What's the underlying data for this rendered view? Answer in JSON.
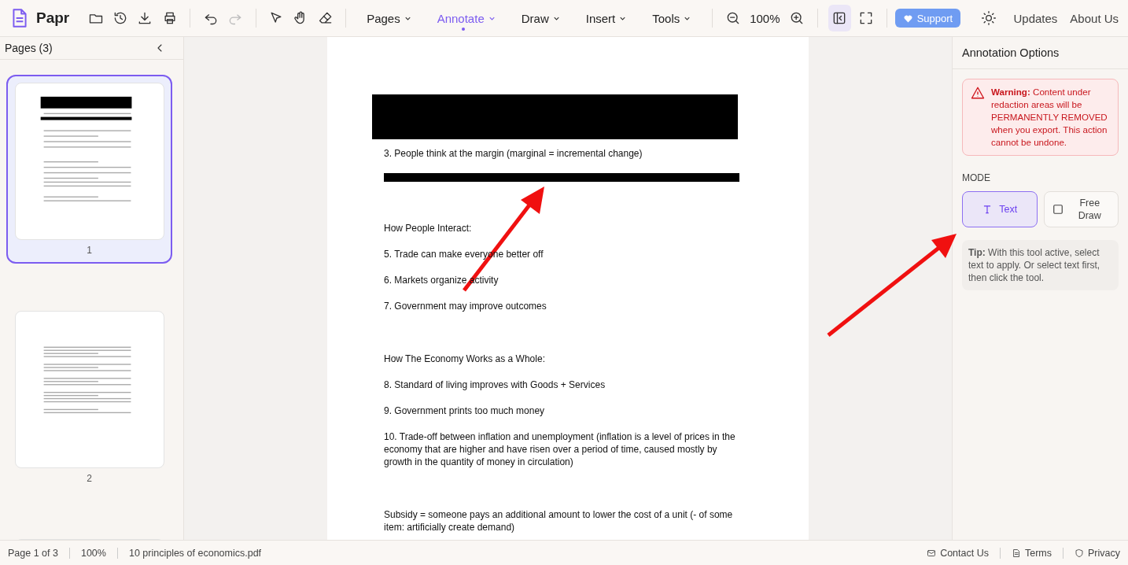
{
  "toolbar": {
    "app_name": "Papr",
    "menus": [
      {
        "label": "Pages",
        "selected": false
      },
      {
        "label": "Annotate",
        "selected": true
      },
      {
        "label": "Draw",
        "selected": false
      },
      {
        "label": "Insert",
        "selected": false
      },
      {
        "label": "Tools",
        "selected": false
      }
    ],
    "zoom": "100%",
    "support": "Support",
    "links": [
      "Updates",
      "About Us"
    ]
  },
  "sidebar": {
    "title": "Pages (3)",
    "pages": [
      {
        "number": "1",
        "selected": true
      },
      {
        "number": "2",
        "selected": false
      },
      {
        "selected": false
      }
    ]
  },
  "document": {
    "lines": [
      {
        "kind": "redaction"
      },
      {
        "kind": "text",
        "text": "3. People think at the margin (marginal = incremental change)"
      },
      {
        "kind": "redaction-bar"
      },
      {
        "kind": "blank"
      },
      {
        "kind": "text",
        "text": "How People Interact:"
      },
      {
        "kind": "text",
        "text": "5. Trade can make everyone better off"
      },
      {
        "kind": "text",
        "text": "6. Markets organize activity"
      },
      {
        "kind": "text",
        "text": "7. Government may improve outcomes"
      },
      {
        "kind": "blank"
      },
      {
        "kind": "text",
        "text": "How The Economy Works as a Whole:"
      },
      {
        "kind": "text",
        "text": "8. Standard of living improves with Goods + Services"
      },
      {
        "kind": "text",
        "text": "9. Government prints too much money"
      },
      {
        "kind": "text",
        "text": "10. Trade-off between inflation and unemployment (inflation is a level of prices in the economy that are higher and have risen over a period of time, caused mostly by growth in the quantity of money in circulation)"
      },
      {
        "kind": "blank"
      },
      {
        "kind": "text",
        "text": "Subsidy = someone pays an additional amount to lower the cost of a unit (- of some item: artificially create demand)"
      }
    ]
  },
  "panel": {
    "title": "Annotation Options",
    "warning": "**Warning:** Content under redaction areas will be PERMANENTLY REMOVED when you export. This action cannot be undone.",
    "mode_label": "MODE",
    "modes": [
      {
        "kind": "text",
        "label": "Text",
        "selected": true
      },
      {
        "kind": "draw",
        "label": "Free Draw",
        "selected": false
      }
    ],
    "tip": "**Tip:** With this tool active, select text to apply. Or select text first, then click the tool."
  },
  "status_bar": {
    "page": "Page 1 of 3",
    "zoom": "100%",
    "file": "10 principles of economics.pdf",
    "links": [
      {
        "kind": "contact",
        "label": "Contact Us"
      },
      {
        "kind": "terms",
        "label": "Terms"
      },
      {
        "kind": "privacy",
        "label": "Privacy"
      }
    ]
  }
}
